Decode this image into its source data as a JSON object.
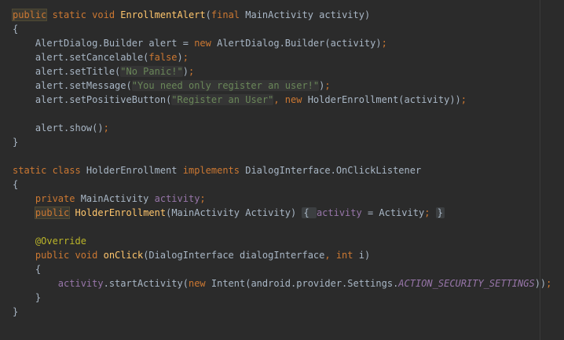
{
  "editor": {
    "lines": [
      [
        {
          "t": "public",
          "c": "kw-hl"
        },
        {
          "t": " static void ",
          "c": "kw"
        },
        {
          "t": "EnrollmentAlert",
          "c": "fn"
        },
        {
          "t": "(",
          "c": "plain"
        },
        {
          "t": "final ",
          "c": "kw"
        },
        {
          "t": "MainActivity activity)",
          "c": "plain"
        }
      ],
      [
        {
          "t": "{",
          "c": "plain"
        }
      ],
      [
        {
          "t": "    AlertDialog.Builder alert = ",
          "c": "plain"
        },
        {
          "t": "new ",
          "c": "kw"
        },
        {
          "t": "AlertDialog.Builder(activity)",
          "c": "plain"
        },
        {
          "t": ";",
          "c": "op"
        }
      ],
      [
        {
          "t": "    alert.setCancelable(",
          "c": "plain"
        },
        {
          "t": "false",
          "c": "kw"
        },
        {
          "t": ")",
          "c": "plain"
        },
        {
          "t": ";",
          "c": "op"
        }
      ],
      [
        {
          "t": "    alert.setTitle(",
          "c": "plain"
        },
        {
          "t": "\"No Panic!\"",
          "c": "str str-box"
        },
        {
          "t": ")",
          "c": "plain"
        },
        {
          "t": ";",
          "c": "op"
        }
      ],
      [
        {
          "t": "    alert.setMessage(",
          "c": "plain"
        },
        {
          "t": "\"You need only register an user!\"",
          "c": "str str-box"
        },
        {
          "t": ")",
          "c": "plain"
        },
        {
          "t": ";",
          "c": "op"
        }
      ],
      [
        {
          "t": "    alert.setPositiveButton(",
          "c": "plain"
        },
        {
          "t": "\"Register an User\"",
          "c": "str str-box"
        },
        {
          "t": ", ",
          "c": "op"
        },
        {
          "t": "new ",
          "c": "kw"
        },
        {
          "t": "HolderEnrollment(activity))",
          "c": "plain"
        },
        {
          "t": ";",
          "c": "op"
        }
      ],
      [],
      [
        {
          "t": "    alert.show()",
          "c": "plain"
        },
        {
          "t": ";",
          "c": "op"
        }
      ],
      [
        {
          "t": "}",
          "c": "plain"
        }
      ],
      [],
      [
        {
          "t": "static class ",
          "c": "kw"
        },
        {
          "t": "HolderEnrollment ",
          "c": "plain"
        },
        {
          "t": "implements ",
          "c": "kw"
        },
        {
          "t": "DialogInterface.OnClickListener",
          "c": "plain"
        }
      ],
      [
        {
          "t": "{",
          "c": "plain"
        }
      ],
      [
        {
          "t": "    ",
          "c": "plain"
        },
        {
          "t": "private ",
          "c": "kw"
        },
        {
          "t": "MainActivity ",
          "c": "plain"
        },
        {
          "t": "activity",
          "c": "field"
        },
        {
          "t": ";",
          "c": "op"
        }
      ],
      [
        {
          "t": "    ",
          "c": "plain"
        },
        {
          "t": "public",
          "c": "kw-hl"
        },
        {
          "t": " ",
          "c": "plain"
        },
        {
          "t": "HolderEnrollment",
          "c": "fn"
        },
        {
          "t": "(MainActivity Activity) ",
          "c": "plain"
        },
        {
          "t": "{ ",
          "c": "plain fold"
        },
        {
          "t": "activity",
          "c": "field"
        },
        {
          "t": " = Activity",
          "c": "plain"
        },
        {
          "t": "; ",
          "c": "op"
        },
        {
          "t": "}",
          "c": "plain fold"
        }
      ],
      [],
      [
        {
          "t": "    @Override",
          "c": "ann"
        }
      ],
      [
        {
          "t": "    ",
          "c": "plain"
        },
        {
          "t": "public void ",
          "c": "kw"
        },
        {
          "t": "onClick",
          "c": "fn"
        },
        {
          "t": "(DialogInterface dialogInterface",
          "c": "plain"
        },
        {
          "t": ", ",
          "c": "op"
        },
        {
          "t": "int ",
          "c": "kw"
        },
        {
          "t": "i)",
          "c": "plain"
        }
      ],
      [
        {
          "t": "    {",
          "c": "plain"
        }
      ],
      [
        {
          "t": "        ",
          "c": "plain"
        },
        {
          "t": "activity",
          "c": "field"
        },
        {
          "t": ".startActivity(",
          "c": "plain"
        },
        {
          "t": "new ",
          "c": "kw"
        },
        {
          "t": "Intent(android.provider.Settings.",
          "c": "plain"
        },
        {
          "t": "ACTION_SECURITY_SETTINGS",
          "c": "const"
        },
        {
          "t": "))",
          "c": "plain"
        },
        {
          "t": ";",
          "c": "op"
        }
      ],
      [
        {
          "t": "    }",
          "c": "plain"
        }
      ],
      [
        {
          "t": "}",
          "c": "plain"
        }
      ]
    ]
  }
}
